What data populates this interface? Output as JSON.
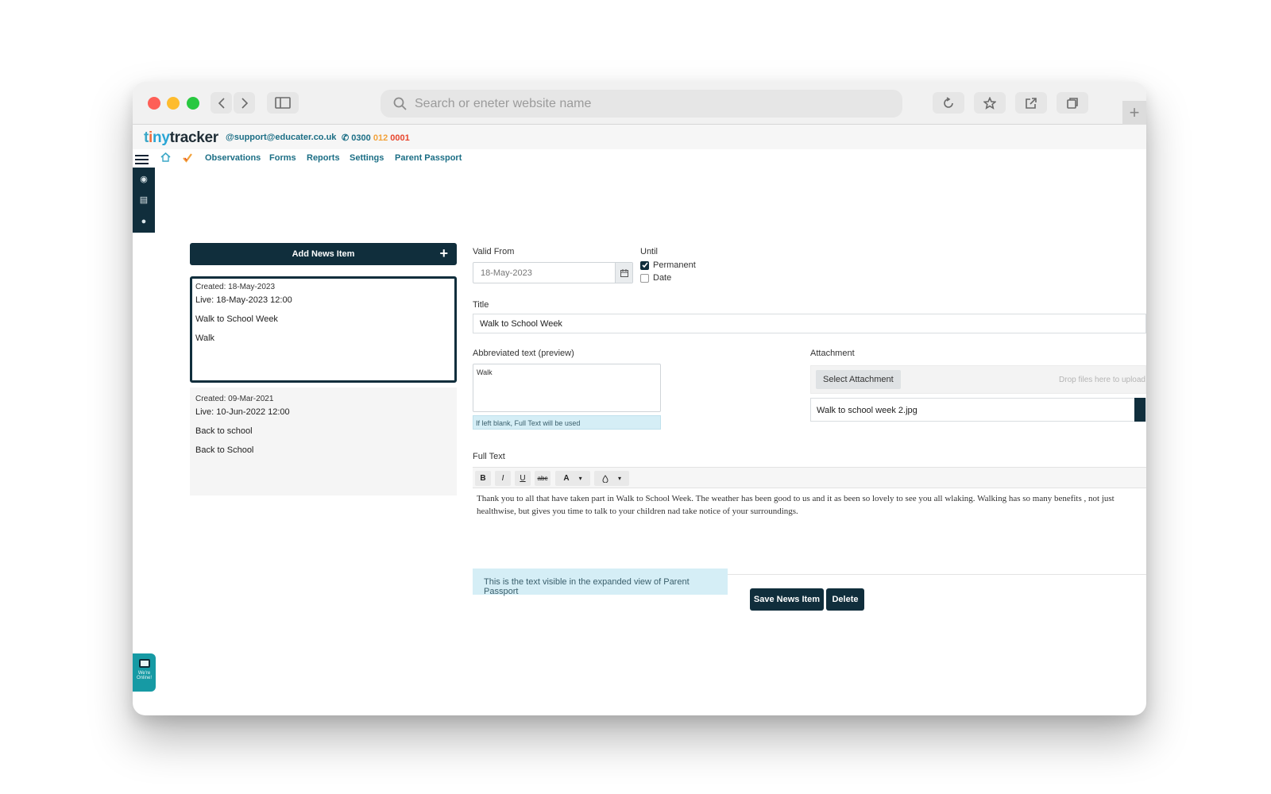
{
  "browser": {
    "search_placeholder": "Search or eneter website name",
    "new_tab_symbol": "+"
  },
  "header": {
    "logo_parts": [
      "t",
      "i",
      "ny",
      "tracker"
    ],
    "email": "@support@educater.co.uk",
    "phone_prefix": "0300",
    "phone_mid": "012",
    "phone_suffix": "0001"
  },
  "nav": {
    "links": [
      "Observations",
      "Forms",
      "Reports",
      "Settings",
      "Parent Passport"
    ]
  },
  "news_list": {
    "add_label": "Add News Item",
    "add_symbol": "+",
    "items": [
      {
        "created": "Created: 18-May-2023",
        "live": "Live: 18-May-2023 12:00",
        "title": "Walk to School Week",
        "abbr": "Walk"
      },
      {
        "created": "Created: 09-Mar-2021",
        "live": "Live: 10-Jun-2022 12:00",
        "title": "Back to school",
        "abbr": "Back to School"
      }
    ]
  },
  "form": {
    "valid_from_label": "Valid From",
    "valid_from_value": "18-May-2023",
    "until_label": "Until",
    "permanent_label": "Permanent",
    "permanent_checked": true,
    "date_label": "Date",
    "date_checked": false,
    "title_label": "Title",
    "title_value": "Walk to School Week",
    "abbr_label": "Abbreviated text (preview)",
    "abbr_value": "Walk",
    "abbr_hint": "If left blank, Full Text will be used",
    "attachment_label": "Attachment",
    "select_attachment": "Select Attachment",
    "drop_text": "Drop files here to upload",
    "attachment_file": "Walk to school week 2.jpg",
    "full_text_label": "Full Text",
    "full_text": "Thank you to all that have taken part in Walk to School Week. The weather has been good to us and it as been so lovely to see you all wlaking. Walking has so many benefits , not just healthwise, but gives you time to talk to your children nad take notice of  your surroundings.",
    "full_text_hint": "This is the text visible in the expanded view of Parent Passport",
    "save_label": "Save News Item",
    "delete_label": "Delete"
  },
  "toolbar": {
    "bold": "B",
    "italic": "I",
    "underline": "U",
    "strike": "abc",
    "font_color": "A",
    "caret": "▾"
  },
  "chat": {
    "status": "We're Online!"
  },
  "colors": {
    "primary_dark": "#102e3c",
    "link_teal": "#1b6e85",
    "hint_bg": "#d5eef6",
    "chat_teal": "#169aa4"
  }
}
